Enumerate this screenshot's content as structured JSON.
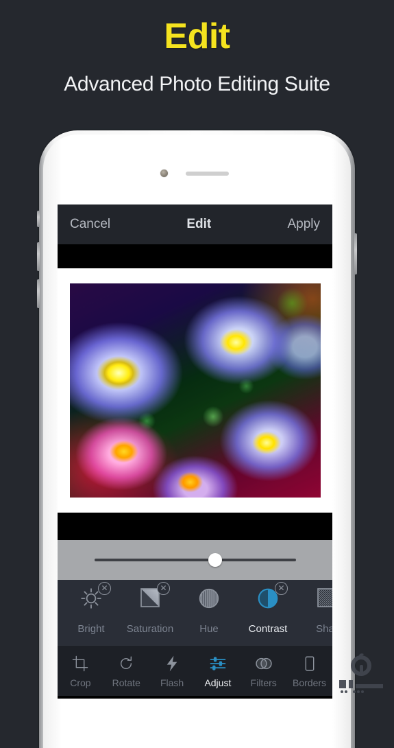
{
  "promo": {
    "title": "Edit",
    "subtitle": "Advanced Photo Editing Suite",
    "title_color": "#f5e31f",
    "background_color": "#25282e"
  },
  "app": {
    "navbar": {
      "cancel_label": "Cancel",
      "title": "Edit",
      "apply_label": "Apply"
    },
    "photo": {
      "description": "Purple and blue daisy flowers with yellow centers, scalloped border frame"
    },
    "slider": {
      "value_percent": 60,
      "min": 0,
      "max": 100
    },
    "adjustments": [
      {
        "label": "Bright",
        "icon": "sun-icon",
        "active": false,
        "has_reset": true
      },
      {
        "label": "Saturation",
        "icon": "saturation-square-icon",
        "active": false,
        "has_reset": true
      },
      {
        "label": "Hue",
        "icon": "hue-circle-icon",
        "active": false,
        "has_reset": false
      },
      {
        "label": "Contrast",
        "icon": "contrast-circle-icon",
        "active": true,
        "has_reset": true
      },
      {
        "label": "Shar",
        "icon": "sharpen-square-icon",
        "active": false,
        "has_reset": false
      }
    ],
    "toolbar": [
      {
        "label": "Crop",
        "icon": "crop-icon",
        "active": false
      },
      {
        "label": "Rotate",
        "icon": "rotate-icon",
        "active": false
      },
      {
        "label": "Flash",
        "icon": "flash-icon",
        "active": false
      },
      {
        "label": "Adjust",
        "icon": "adjust-sliders-icon",
        "active": true
      },
      {
        "label": "Filters",
        "icon": "filters-icon",
        "active": false
      },
      {
        "label": "Borders",
        "icon": "borders-icon",
        "active": false
      }
    ],
    "accent_color": "#2a8fc4",
    "inactive_color": "#70757f"
  },
  "watermark": {
    "name": "site-logo-watermark"
  }
}
